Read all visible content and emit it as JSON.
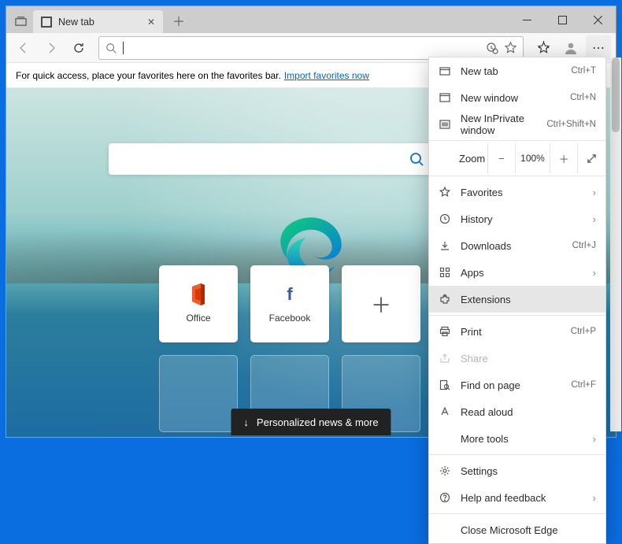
{
  "tab": {
    "title": "New tab"
  },
  "favbar": {
    "text": "For quick access, place your favorites here on the favorites bar.",
    "link": "Import favorites now"
  },
  "tiles": [
    {
      "label": "Office"
    },
    {
      "label": "Facebook"
    }
  ],
  "news": {
    "label": "Personalized news & more"
  },
  "menu": {
    "newtab": {
      "label": "New tab",
      "shortcut": "Ctrl+T"
    },
    "newwin": {
      "label": "New window",
      "shortcut": "Ctrl+N"
    },
    "inprivate": {
      "label": "New InPrivate window",
      "shortcut": "Ctrl+Shift+N"
    },
    "zoom": {
      "label": "Zoom",
      "value": "100%"
    },
    "favorites": {
      "label": "Favorites"
    },
    "history": {
      "label": "History"
    },
    "downloads": {
      "label": "Downloads",
      "shortcut": "Ctrl+J"
    },
    "apps": {
      "label": "Apps"
    },
    "extensions": {
      "label": "Extensions"
    },
    "print": {
      "label": "Print",
      "shortcut": "Ctrl+P"
    },
    "share": {
      "label": "Share"
    },
    "find": {
      "label": "Find on page",
      "shortcut": "Ctrl+F"
    },
    "read": {
      "label": "Read aloud"
    },
    "tools": {
      "label": "More tools"
    },
    "settings": {
      "label": "Settings"
    },
    "help": {
      "label": "Help and feedback"
    },
    "close": {
      "label": "Close Microsoft Edge"
    }
  }
}
